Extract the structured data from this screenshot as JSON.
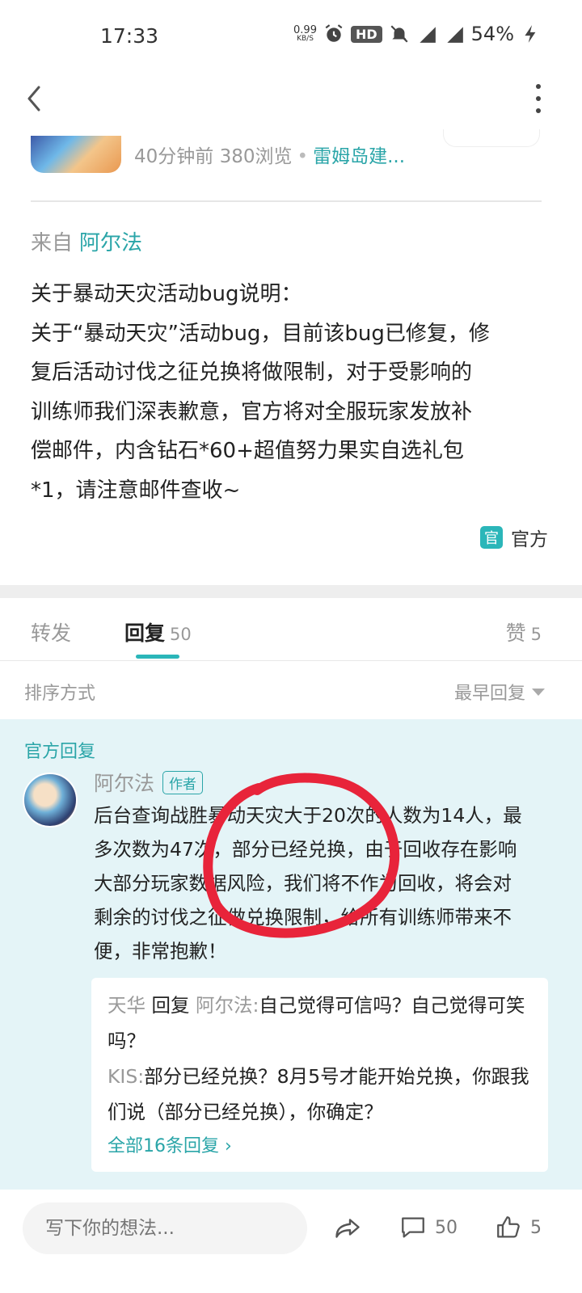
{
  "status_bar": {
    "time": "17:33",
    "net_speed": "0.99",
    "net_unit": "KB/S",
    "hd": "HD",
    "signal_5g": "5G",
    "signal_4g": "4G",
    "battery": "54%"
  },
  "post": {
    "time_ago": "40分钟前",
    "views": "380浏览",
    "dot": "•",
    "category": "雷姆岛建...",
    "from_label": "来自",
    "from_name": "阿尔法",
    "body_lines": [
      "关于暴动天灾活动bug说明：",
      "关于“暴动天灾”活动bug，目前该bug已修复，修",
      "复后活动讨伐之征兑换将做限制，对于受影响的",
      "训练师我们深表歉意，官方将对全服玩家发放补",
      "偿邮件，内含钻石*60+超值努力果实自选礼包",
      "*1，请注意邮件查收~"
    ],
    "official_icon": "官",
    "official_label": "官方"
  },
  "tabs": {
    "forward": "转发",
    "reply": "回复",
    "reply_count": "50",
    "like": "赞",
    "like_count": "5"
  },
  "sort": {
    "label": "排序方式",
    "value": "最早回复"
  },
  "official_reply": {
    "section_title": "官方回复",
    "author": "阿尔法",
    "author_badge": "作者",
    "body_lines": [
      "后台查询战胜暴动天灾大于20次的人数为14人，最",
      "多次数为47次，部分已经兑换，由于回收存在影响",
      "大部分玩家数据风险，我们将不作为回收，将会对",
      "剩余的讨伐之征做兑换限制，给所有训练师带来不",
      "便，非常抱歉！"
    ],
    "subreplies": [
      {
        "user": "天华",
        "verb": "回复",
        "target": "阿尔法",
        "sep": ":",
        "text": "自己觉得可信吗？自己觉得可笑吗？"
      },
      {
        "user": "KIS",
        "sep": ":",
        "text": "部分已经兑换？8月5号才能开始兑换，你跟我们说（部分已经兑换），你确定？"
      }
    ],
    "more_replies": "全部16条回复"
  },
  "bottom_bar": {
    "input_placeholder": "写下你的想法...",
    "comment_count": "50",
    "like_count": "5"
  },
  "icons": {
    "back": "chevron-left-icon",
    "more": "more-vertical-icon",
    "share": "share-icon",
    "comment": "comment-icon",
    "like": "thumbs-up-icon"
  },
  "colors": {
    "accent": "#2aa5a8",
    "official_bg": "#e4f4f7",
    "annotation": "#e8243a"
  }
}
